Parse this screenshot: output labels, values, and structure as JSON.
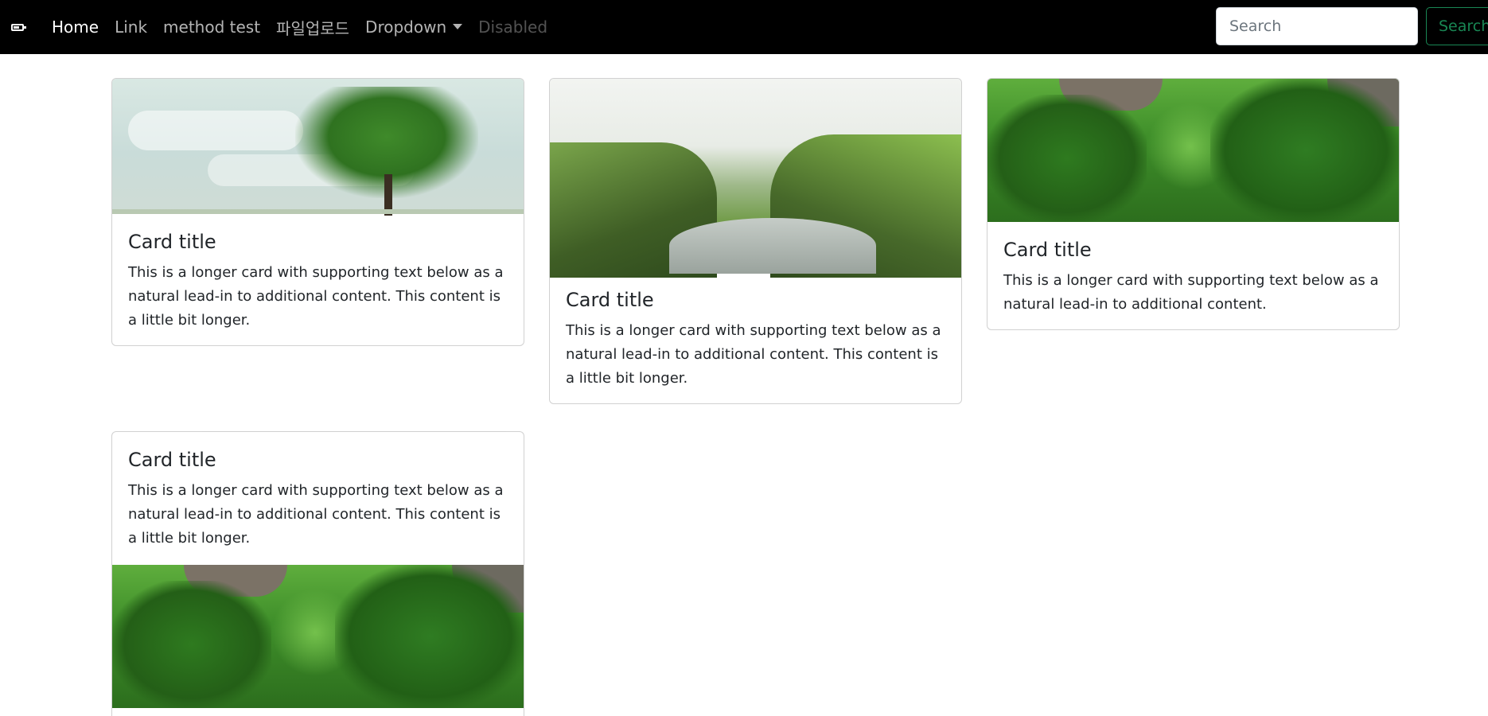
{
  "navbar": {
    "brand_icon": "battery-icon",
    "links": [
      {
        "label": "Home",
        "state": "active"
      },
      {
        "label": "Link",
        "state": "normal"
      },
      {
        "label": "method test",
        "state": "normal"
      },
      {
        "label": "파일업로드",
        "state": "normal"
      },
      {
        "label": "Dropdown",
        "state": "normal"
      },
      {
        "label": "Disabled",
        "state": "disabled"
      }
    ],
    "search": {
      "placeholder": "Search",
      "button_label": "Search"
    },
    "colors": {
      "background": "#000000",
      "search_button": "#198754"
    }
  },
  "cards": [
    {
      "title": "Card title",
      "text": "This is a longer card with supporting text below as a natural lead-in to additional content. This content is a little bit longer.",
      "image": "tree"
    },
    {
      "title": "Card title",
      "text": "This is a longer card with supporting text below as a natural lead-in to additional content. This content is a little bit longer.",
      "image": "canyon"
    },
    {
      "title": "Card title",
      "text": "This is a longer card with supporting text below as a natural lead-in to additional content.",
      "image": "bushes"
    },
    {
      "title": "Card title",
      "text": "This is a longer card with supporting text below as a natural lead-in to additional content. This content is a little bit longer.",
      "image": "bushes"
    }
  ]
}
